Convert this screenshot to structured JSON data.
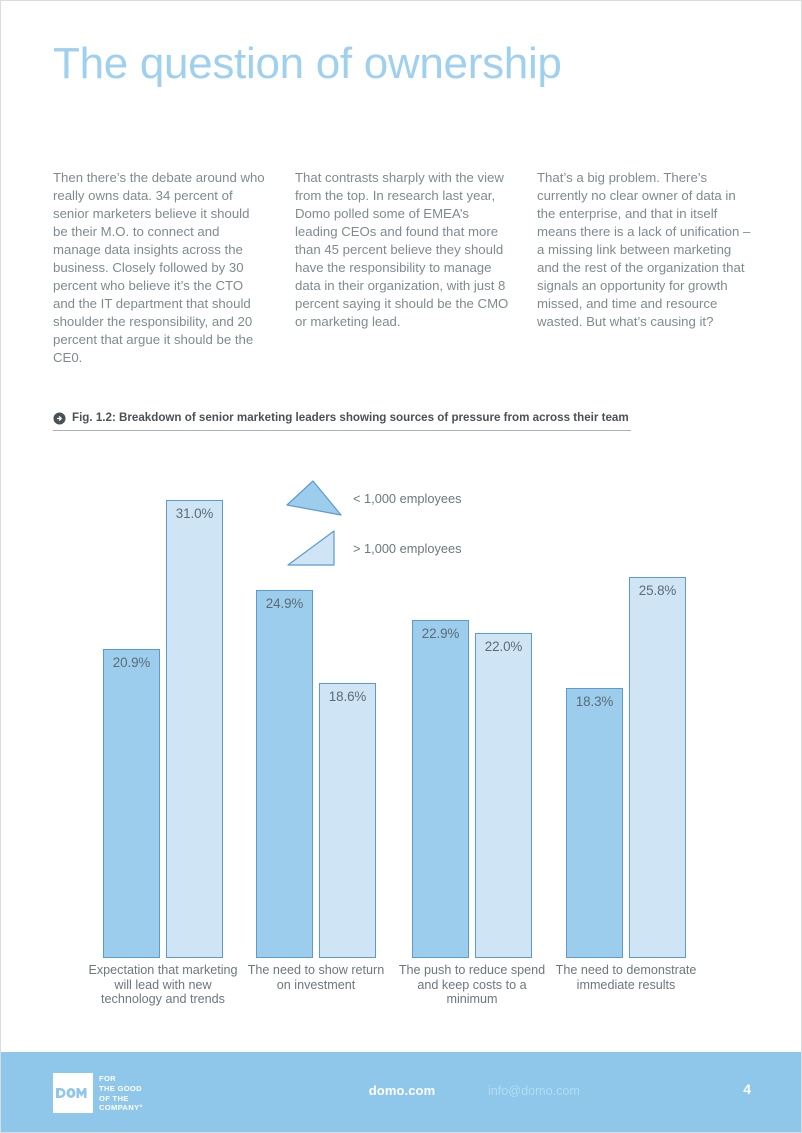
{
  "page": {
    "title": "The question of ownership",
    "accent_color": "#9fd0ee",
    "footer_color": "#8ec7ea"
  },
  "columns": [
    {
      "text": "Then there’s the debate around who really owns data. 34 percent of senior marketers believe it should be their M.O. to connect and manage data insights across the business. Closely followed by 30 percent who believe it’s the CTO and the IT department that should shoulder the responsibility, and 20 percent that argue it should be the CE0."
    },
    {
      "text": "That contrasts sharply with the view from the top. In research last year, Domo polled some of EMEA’s leading CEOs and found that more than 45 percent believe they should have the responsibility to manage data in their organization, with just 8 percent saying it should be the CMO or marketing lead."
    },
    {
      "text": "That’s a big problem. There’s currently no clear owner of data in the enterprise, and that in itself means there is a lack of unification – a missing link between marketing and the rest of the organization that signals an opportunity for growth missed, and time and resource wasted. But what’s causing it?"
    }
  ],
  "figure": {
    "caption": "Fig. 1.2: Breakdown of senior marketing leaders showing sources of pressure from across their team",
    "arrow_icon": "circle-arrow-right-icon"
  },
  "chart_data": {
    "type": "bar",
    "title": "Fig. 1.2: Breakdown of senior marketing leaders showing sources of pressure from across their team",
    "xlabel": "",
    "ylabel": "",
    "ylim": [
      0,
      34
    ],
    "grid": false,
    "legend_position": "inside-top-center",
    "categories": [
      "Expectation that marketing will lead with new technology and trends",
      "The need to show return on investment",
      "The push to reduce spend and keep costs to a minimum",
      "The need to demonstrate immediate results"
    ],
    "series": [
      {
        "name": "< 1,000 employees",
        "color": "#9ccdec",
        "border": "#5b9bd1",
        "values": [
          20.9,
          24.9,
          22.9,
          18.3
        ],
        "labels": [
          "20.9%",
          "24.9%",
          "22.9%",
          "18.3%"
        ]
      },
      {
        "name": "> 1,000 employees",
        "color": "#cfe5f6",
        "border": "#5b9bd1",
        "values": [
          31.0,
          18.6,
          22.0,
          25.8
        ],
        "labels": [
          "31.0%",
          "18.6%",
          "22.0%",
          "25.8%"
        ]
      }
    ]
  },
  "legend": [
    {
      "label": "< 1,000 employees",
      "swatch": "triangle-obtuse-icon",
      "color": "#9ccdec"
    },
    {
      "label": "> 1,000 employees",
      "swatch": "triangle-right-icon",
      "color": "#cfe5f6"
    }
  ],
  "footer": {
    "logo_word": "DOMO",
    "tagline_lines": [
      "FOR",
      "THE GOOD",
      "OF THE",
      "COMPANY°"
    ],
    "site": "domo.com",
    "email": "info@domo.com",
    "page_number": "4"
  }
}
